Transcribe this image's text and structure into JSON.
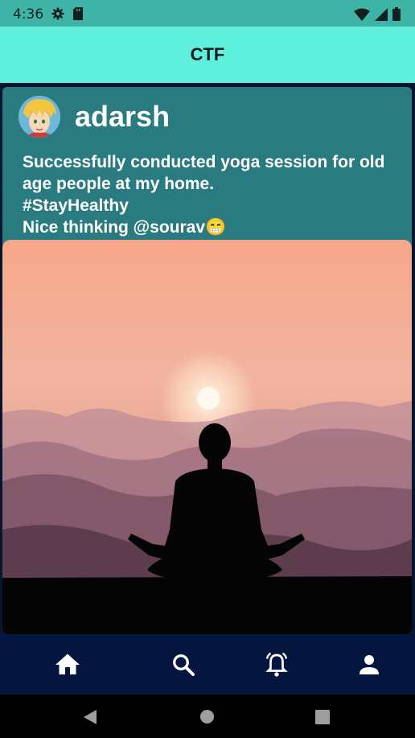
{
  "status_bar": {
    "time": "4:36",
    "icons": [
      "gear-icon",
      "sd-card-icon",
      "wifi-icon",
      "signal-icon",
      "battery-icon"
    ]
  },
  "app_bar": {
    "title": "CTF"
  },
  "post": {
    "username": "adarsh",
    "lines": [
      "Successfully conducted yoga session for old",
      "age people at my home.",
      "#StayHealthy",
      "Nice thinking @sourav😁"
    ],
    "image": "meditation-silhouette-sunset-mountains"
  },
  "fab": {
    "label": "+"
  },
  "bottom_nav": {
    "items": [
      "home-icon",
      "search-icon",
      "notifications-icon",
      "profile-icon"
    ]
  },
  "system_nav": {
    "items": [
      "back-icon",
      "home-circle-icon",
      "recents-icon"
    ]
  },
  "colors": {
    "accent": "#5ef0dc",
    "card": "#2a7b80",
    "nav": "#04163f",
    "status": "#3fb4a6"
  }
}
